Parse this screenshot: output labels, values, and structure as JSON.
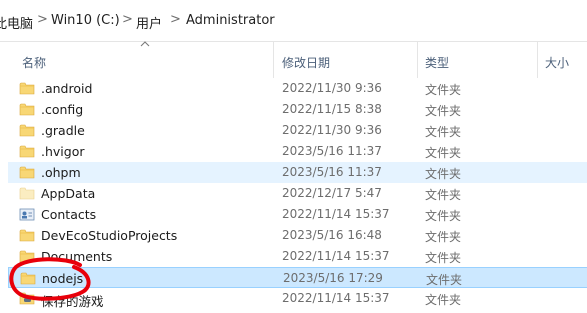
{
  "breadcrumb": {
    "items": [
      "此电脑",
      "Win10 (C:)",
      "用户",
      "Administrator"
    ],
    "separator": ">"
  },
  "columns": {
    "name": "名称",
    "modified": "修改日期",
    "type": "类型",
    "size": "大小"
  },
  "rows": [
    {
      "name": ".android",
      "modified": "2022/11/30 9:36",
      "type": "文件夹",
      "icon": "folder-icon"
    },
    {
      "name": ".config",
      "modified": "2022/11/15 8:38",
      "type": "文件夹",
      "icon": "folder-icon"
    },
    {
      "name": ".gradle",
      "modified": "2022/11/30 9:36",
      "type": "文件夹",
      "icon": "folder-icon"
    },
    {
      "name": ".hvigor",
      "modified": "2023/5/16 11:37",
      "type": "文件夹",
      "icon": "folder-icon"
    },
    {
      "name": ".ohpm",
      "modified": "2023/5/16 11:37",
      "type": "文件夹",
      "icon": "folder-icon"
    },
    {
      "name": "AppData",
      "modified": "2022/12/17 5:47",
      "type": "文件夹",
      "icon": "hidden-folder-icon"
    },
    {
      "name": "Contacts",
      "modified": "2022/11/14 15:37",
      "type": "文件夹",
      "icon": "contacts-folder-icon"
    },
    {
      "name": "DevEcoStudioProjects",
      "modified": "2023/5/16 16:48",
      "type": "文件夹",
      "icon": "folder-icon"
    },
    {
      "name": "Documents",
      "modified": "2022/11/14 15:37",
      "type": "文件夹",
      "icon": "folder-icon"
    },
    {
      "name": "nodejs",
      "modified": "2023/5/16 17:29",
      "type": "文件夹",
      "icon": "folder-icon"
    },
    {
      "name": "保存的游戏",
      "modified": "2022/11/14 15:37",
      "type": "文件夹",
      "icon": "saved-games-folder-icon"
    }
  ],
  "hover_row": ".ohpm",
  "selected_row": "nodejs",
  "colors": {
    "folder": "#f8d775",
    "hover": "#e5f3ff",
    "selected": "#cce8ff",
    "annotation": "#e8000b"
  }
}
